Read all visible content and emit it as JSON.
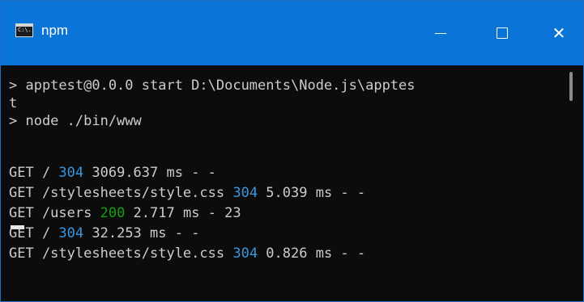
{
  "window": {
    "title": "npm",
    "icon": "terminal-icon",
    "icon_text": "C:\\.",
    "accent_color": "#0a74d7"
  },
  "controls": {
    "minimize": "minimize-icon",
    "maximize": "maximize-icon",
    "close": "close-icon",
    "close_glyph": "✕"
  },
  "console": {
    "prompt_line_1": "> apptest@0.0.0 start D:\\Documents\\Node.js\\apptes",
    "prompt_line_1_wrap": "t",
    "prompt_line_2": "> node ./bin/www",
    "log": [
      {
        "pre": "GET / ",
        "status": "304",
        "post": " 3069.637 ms - -"
      },
      {
        "pre": "GET /stylesheets/style.css ",
        "status": "304",
        "post": " 5.039 ms - -"
      },
      {
        "pre": "GET /users ",
        "status": "200",
        "post": " 2.717 ms - 23"
      },
      {
        "pre": "GET / ",
        "status": "304",
        "post": " 32.253 ms - -"
      },
      {
        "pre": "GET /stylesheets/style.css ",
        "status": "304",
        "post": " 0.826 ms - -"
      }
    ],
    "status_colors": {
      "304": "#3a96dd",
      "200": "#13a10e"
    }
  }
}
